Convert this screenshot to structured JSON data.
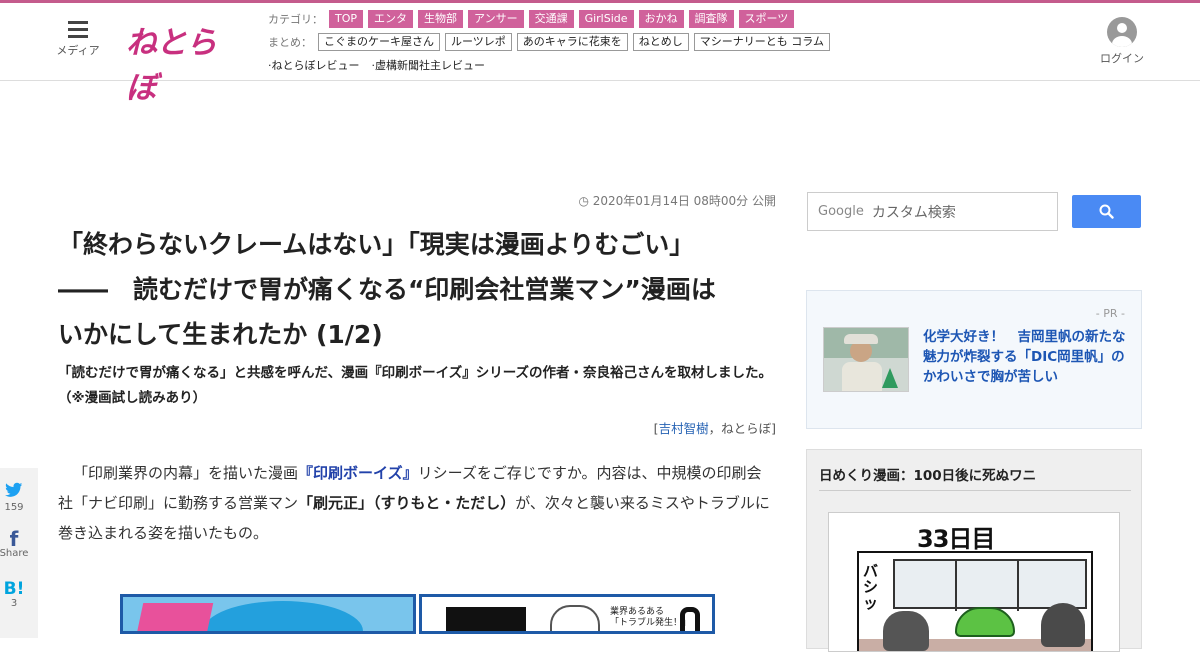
{
  "header": {
    "menu_label": "メディア",
    "logo_text": "ねとらぼ",
    "categories_label": "カテゴリ：",
    "categories": [
      "TOP",
      "エンタ",
      "生物部",
      "アンサー",
      "交通課",
      "GirlSide",
      "おかね",
      "調査隊",
      "スポーツ"
    ],
    "summary_label": "まとめ：",
    "summaries": [
      "こぐまのケーキ屋さん",
      "ルーツレポ",
      "あのキャラに花束を",
      "ねとめし",
      "マシーナリーとも コラム"
    ],
    "reviews": [
      "ねとらぼレビュー",
      "虚構新聞社主レビュー"
    ],
    "login_label": "ログイン"
  },
  "article": {
    "pubdate": "2020年01月14日 08時00分 公開",
    "title_line1": "「終わらないクレームはない」「現実は漫画よりむごい」",
    "title_line2": "――　読むだけで胃が痛くなる“印刷会社営業マン”漫画は",
    "title_line3": "いかにして生まれたか (1/2)",
    "lead": "「読むだけで胃が痛くなる」と共感を呼んだ、漫画『印刷ボーイズ』シリーズの作者・奈良裕己さんを取材しました。（※漫画試し読みあり）",
    "byline_open": "[",
    "author": "吉村智樹",
    "byline_sep": "，",
    "site": "ねとらぼ",
    "byline_close": "]",
    "body_1": "「印刷業界の内幕」を描いた漫画",
    "body_manga": "『印刷ボーイズ』",
    "body_2": "リシーズをご存じですか。内容は、中規模の印刷会社「ナビ印刷」に勤務する営業マン",
    "body_name": "「刷元正」（すりもと・ただし）",
    "body_3": "が、次々と襲い来るミスやトラブルに巻き込まれる姿を描いたもの。",
    "figure2_text1": "業界あるある",
    "figure2_text2": "「トラブル発生！」"
  },
  "share": {
    "twitter_icon": "twitter-icon",
    "twitter_count": "159",
    "facebook_label": "Share",
    "hatena_icon_text": "B!",
    "hatena_count": "3"
  },
  "sidebar": {
    "search_logo": "Google",
    "search_placeholder": "カスタム検索",
    "pr_tag": "- PR -",
    "pr_link": "化学大好き！　吉岡里帆の新たな魅力が炸裂する「DIC岡里帆」のかわいさで胸が苦しい",
    "comic_title": "日めくり漫画：100日後に死ぬワニ",
    "comic_day": "33日目",
    "comic_sfx": "バシッ"
  },
  "colors": {
    "accent": "#c45b8c",
    "category_bg": "#d0619b",
    "link": "#1d56b4",
    "search_button": "#4a8af4"
  }
}
